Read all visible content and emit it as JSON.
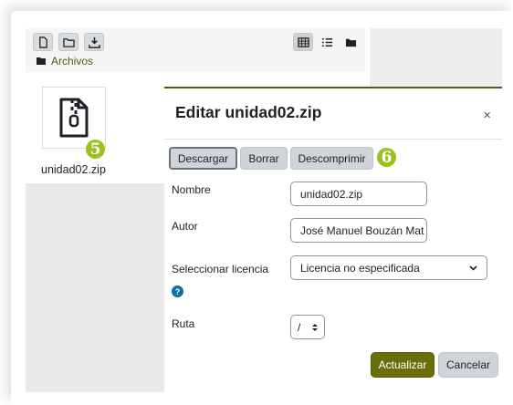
{
  "toolbar": {
    "buttons": [
      "new-file-icon",
      "new-folder-icon",
      "download-icon"
    ],
    "views": [
      "grid-view-icon",
      "list-view-icon",
      "folder-view-icon"
    ]
  },
  "breadcrumb": {
    "label": "Archivos"
  },
  "file": {
    "name": "unidad02.zip",
    "icon": "zip-file-icon",
    "badge": "5"
  },
  "dialog": {
    "title": "Editar unidad02.zip",
    "close_label": "×",
    "actions": {
      "download": "Descargar",
      "delete": "Borrar",
      "unzip": "Descomprimir"
    },
    "actions_badge": "6",
    "fields": {
      "name_label": "Nombre",
      "name_value": "unidad02.zip",
      "author_label": "Autor",
      "author_value": "José Manuel Bouzán Mat",
      "license_label": "Seleccionar licencia",
      "license_value": "Licencia no especificada",
      "path_label": "Ruta",
      "path_value": "/"
    },
    "update_label": "Actualizar",
    "cancel_label": "Cancelar"
  },
  "colors": {
    "accent": "#6b6d0b",
    "badge": "#9cc11c",
    "help": "#0f6fa8"
  }
}
